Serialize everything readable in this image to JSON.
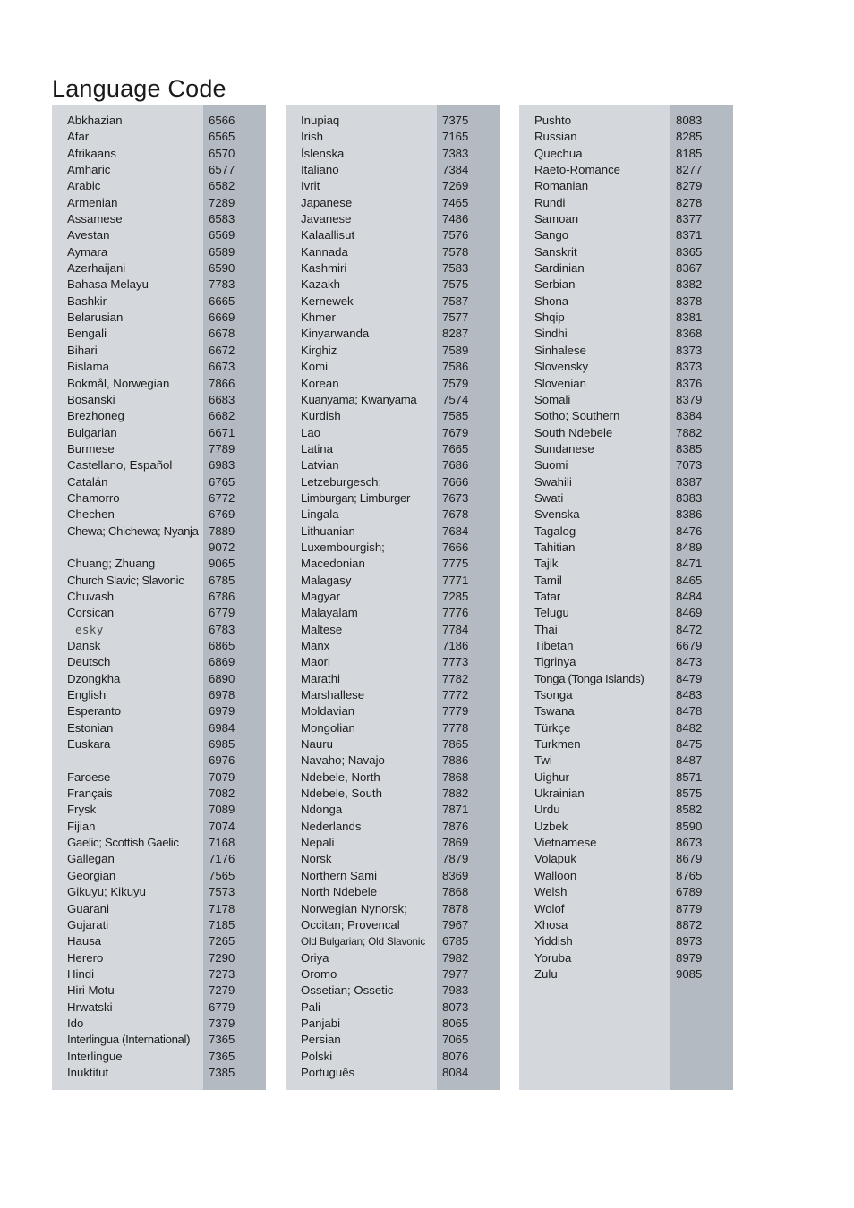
{
  "page": {
    "title": "Language Code"
  },
  "columns": [
    {
      "id": "column-1",
      "rows": [
        {
          "name": "Abkhazian",
          "code": "6566"
        },
        {
          "name": "Afar",
          "code": "6565"
        },
        {
          "name": "Afrikaans",
          "code": "6570"
        },
        {
          "name": "Amharic",
          "code": "6577"
        },
        {
          "name": "Arabic",
          "code": "6582"
        },
        {
          "name": "Armenian",
          "code": "7289"
        },
        {
          "name": "Assamese",
          "code": "6583"
        },
        {
          "name": "Avestan",
          "code": "6569"
        },
        {
          "name": "Aymara",
          "code": "6589"
        },
        {
          "name": "Azerhaijani",
          "code": "6590"
        },
        {
          "name": "Bahasa Melayu",
          "code": "7783"
        },
        {
          "name": "Bashkir",
          "code": "6665"
        },
        {
          "name": "Belarusian",
          "code": "6669"
        },
        {
          "name": "Bengali",
          "code": "6678"
        },
        {
          "name": "Bihari",
          "code": "6672"
        },
        {
          "name": "Bislama",
          "code": "6673"
        },
        {
          "name": "Bokmål, Norwegian",
          "code": "7866"
        },
        {
          "name": "Bosanski",
          "code": "6683"
        },
        {
          "name": "Brezhoneg",
          "code": "6682"
        },
        {
          "name": "Bulgarian",
          "code": "6671"
        },
        {
          "name": "Burmese",
          "code": "7789"
        },
        {
          "name": "Castellano, Español",
          "code": "6983"
        },
        {
          "name": "Catalán",
          "code": "6765"
        },
        {
          "name": "Chamorro",
          "code": "6772"
        },
        {
          "name": "Chechen",
          "code": "6769"
        },
        {
          "name": "Chewa; Chichewa; Nyanja",
          "code": "7889",
          "style": "tight"
        },
        {
          "name": "",
          "code": "9072"
        },
        {
          "name": "Chuang; Zhuang",
          "code": "9065"
        },
        {
          "name": "Church Slavic; Slavonic",
          "code": "6785",
          "style": "tight"
        },
        {
          "name": "Chuvash",
          "code": "6786"
        },
        {
          "name": "Corsican",
          "code": "6779"
        },
        {
          "name": "esky",
          "code": "6783",
          "style": "fallback-glyph"
        },
        {
          "name": "Dansk",
          "code": "6865"
        },
        {
          "name": "Deutsch",
          "code": "6869"
        },
        {
          "name": "Dzongkha",
          "code": "6890"
        },
        {
          "name": "English",
          "code": "6978"
        },
        {
          "name": "Esperanto",
          "code": "6979"
        },
        {
          "name": "Estonian",
          "code": "6984"
        },
        {
          "name": "Euskara",
          "code": "6985"
        },
        {
          "name": "",
          "code": "6976"
        },
        {
          "name": "Faroese",
          "code": "7079"
        },
        {
          "name": "Français",
          "code": "7082"
        },
        {
          "name": "Frysk",
          "code": "7089"
        },
        {
          "name": "Fijian",
          "code": "7074"
        },
        {
          "name": "Gaelic; Scottish Gaelic",
          "code": "7168",
          "style": "tight"
        },
        {
          "name": "Gallegan",
          "code": "7176"
        },
        {
          "name": "Georgian",
          "code": "7565"
        },
        {
          "name": "Gikuyu; Kikuyu",
          "code": "7573"
        },
        {
          "name": "Guarani",
          "code": "7178"
        },
        {
          "name": "Gujarati",
          "code": "7185"
        },
        {
          "name": "Hausa",
          "code": "7265"
        },
        {
          "name": "Herero",
          "code": "7290"
        },
        {
          "name": "Hindi",
          "code": "7273"
        },
        {
          "name": "Hiri Motu",
          "code": "7279"
        },
        {
          "name": "Hrwatski",
          "code": "6779"
        },
        {
          "name": "Ido",
          "code": "7379"
        },
        {
          "name": "Interlingua (International)",
          "code": "7365",
          "style": "tight"
        },
        {
          "name": "Interlingue",
          "code": "7365"
        },
        {
          "name": "Inuktitut",
          "code": "7385"
        }
      ]
    },
    {
      "id": "column-2",
      "rows": [
        {
          "name": "Inupiaq",
          "code": "7375"
        },
        {
          "name": "Irish",
          "code": "7165"
        },
        {
          "name": "Íslenska",
          "code": "7383"
        },
        {
          "name": "Italiano",
          "code": "7384"
        },
        {
          "name": "Ivrit",
          "code": "7269"
        },
        {
          "name": "Japanese",
          "code": "7465"
        },
        {
          "name": "Javanese",
          "code": "7486"
        },
        {
          "name": "Kalaallisut",
          "code": "7576"
        },
        {
          "name": "Kannada",
          "code": "7578"
        },
        {
          "name": "Kashmiri",
          "code": "7583"
        },
        {
          "name": "Kazakh",
          "code": "7575"
        },
        {
          "name": "Kernewek",
          "code": "7587"
        },
        {
          "name": "Khmer",
          "code": "7577"
        },
        {
          "name": "Kinyarwanda",
          "code": "8287"
        },
        {
          "name": "Kirghiz",
          "code": "7589"
        },
        {
          "name": "Komi",
          "code": "7586"
        },
        {
          "name": "Korean",
          "code": "7579"
        },
        {
          "name": "Kuanyama; Kwanyama",
          "code": "7574",
          "style": "tight"
        },
        {
          "name": "Kurdish",
          "code": "7585"
        },
        {
          "name": "Lao",
          "code": "7679"
        },
        {
          "name": "Latina",
          "code": "7665"
        },
        {
          "name": "Latvian",
          "code": "7686"
        },
        {
          "name": "Letzeburgesch;",
          "code": "7666"
        },
        {
          "name": "Limburgan; Limburger",
          "code": "7673",
          "style": "tight"
        },
        {
          "name": "Lingala",
          "code": "7678"
        },
        {
          "name": "Lithuanian",
          "code": "7684"
        },
        {
          "name": "Luxembourgish;",
          "code": "7666"
        },
        {
          "name": "Macedonian",
          "code": "7775"
        },
        {
          "name": "Malagasy",
          "code": "7771"
        },
        {
          "name": "Magyar",
          "code": "7285"
        },
        {
          "name": "Malayalam",
          "code": "7776"
        },
        {
          "name": "Maltese",
          "code": "7784"
        },
        {
          "name": "Manx",
          "code": "7186"
        },
        {
          "name": "Maori",
          "code": "7773"
        },
        {
          "name": "Marathi",
          "code": "7782"
        },
        {
          "name": "Marshallese",
          "code": "7772"
        },
        {
          "name": "Moldavian",
          "code": "7779"
        },
        {
          "name": "Mongolian",
          "code": "7778"
        },
        {
          "name": "Nauru",
          "code": "7865"
        },
        {
          "name": "Navaho; Navajo",
          "code": "7886"
        },
        {
          "name": "Ndebele, North",
          "code": "7868"
        },
        {
          "name": "Ndebele, South",
          "code": "7882"
        },
        {
          "name": "Ndonga",
          "code": "7871"
        },
        {
          "name": "Nederlands",
          "code": "7876"
        },
        {
          "name": "Nepali",
          "code": "7869"
        },
        {
          "name": "Norsk",
          "code": "7879"
        },
        {
          "name": "Northern Sami",
          "code": "8369"
        },
        {
          "name": "North Ndebele",
          "code": "7868"
        },
        {
          "name": "Norwegian Nynorsk;",
          "code": "7878"
        },
        {
          "name": "Occitan; Provencal",
          "code": "7967"
        },
        {
          "name": "Old Bulgarian; Old Slavonic",
          "code": "6785",
          "style": "condensed"
        },
        {
          "name": "Oriya",
          "code": "7982"
        },
        {
          "name": "Oromo",
          "code": "7977"
        },
        {
          "name": "Ossetian; Ossetic",
          "code": "7983"
        },
        {
          "name": "Pali",
          "code": "8073"
        },
        {
          "name": "Panjabi",
          "code": "8065"
        },
        {
          "name": "Persian",
          "code": "7065"
        },
        {
          "name": "Polski",
          "code": "8076"
        },
        {
          "name": "Português",
          "code": "8084"
        }
      ]
    },
    {
      "id": "column-3",
      "rows": [
        {
          "name": "Pushto",
          "code": "8083"
        },
        {
          "name": "Russian",
          "code": "8285"
        },
        {
          "name": "Quechua",
          "code": "8185"
        },
        {
          "name": "Raeto-Romance",
          "code": "8277"
        },
        {
          "name": "Romanian",
          "code": "8279"
        },
        {
          "name": "Rundi",
          "code": "8278"
        },
        {
          "name": "Samoan",
          "code": "8377"
        },
        {
          "name": "Sango",
          "code": "8371"
        },
        {
          "name": "Sanskrit",
          "code": "8365"
        },
        {
          "name": "Sardinian",
          "code": "8367"
        },
        {
          "name": "Serbian",
          "code": "8382"
        },
        {
          "name": "Shona",
          "code": "8378"
        },
        {
          "name": "Shqip",
          "code": "8381"
        },
        {
          "name": "Sindhi",
          "code": "8368"
        },
        {
          "name": "Sinhalese",
          "code": "8373"
        },
        {
          "name": "Slovensky",
          "code": "8373"
        },
        {
          "name": "Slovenian",
          "code": "8376"
        },
        {
          "name": "Somali",
          "code": "8379"
        },
        {
          "name": "Sotho; Southern",
          "code": "8384"
        },
        {
          "name": "South Ndebele",
          "code": "7882"
        },
        {
          "name": "Sundanese",
          "code": "8385"
        },
        {
          "name": "Suomi",
          "code": "7073"
        },
        {
          "name": "Swahili",
          "code": "8387"
        },
        {
          "name": "Swati",
          "code": "8383"
        },
        {
          "name": "Svenska",
          "code": "8386"
        },
        {
          "name": "Tagalog",
          "code": "8476"
        },
        {
          "name": "Tahitian",
          "code": "8489"
        },
        {
          "name": "Tajik",
          "code": "8471"
        },
        {
          "name": "Tamil",
          "code": "8465"
        },
        {
          "name": "Tatar",
          "code": "8484"
        },
        {
          "name": "Telugu",
          "code": "8469"
        },
        {
          "name": "Thai",
          "code": "8472"
        },
        {
          "name": "Tibetan",
          "code": "6679"
        },
        {
          "name": "Tigrinya",
          "code": "8473"
        },
        {
          "name": "Tonga (Tonga Islands)",
          "code": "8479",
          "style": "tight"
        },
        {
          "name": "Tsonga",
          "code": "8483"
        },
        {
          "name": "Tswana",
          "code": "8478"
        },
        {
          "name": "Türkçe",
          "code": "8482"
        },
        {
          "name": "Turkmen",
          "code": "8475"
        },
        {
          "name": "Twi",
          "code": "8487"
        },
        {
          "name": "Uighur",
          "code": "8571"
        },
        {
          "name": "Ukrainian",
          "code": "8575"
        },
        {
          "name": "Urdu",
          "code": "8582"
        },
        {
          "name": "Uzbek",
          "code": "8590"
        },
        {
          "name": "Vietnamese",
          "code": "8673"
        },
        {
          "name": "Volapuk",
          "code": "8679"
        },
        {
          "name": "Walloon",
          "code": "8765"
        },
        {
          "name": "Welsh",
          "code": "6789"
        },
        {
          "name": "Wolof",
          "code": "8779"
        },
        {
          "name": "Xhosa",
          "code": "8872"
        },
        {
          "name": "Yiddish",
          "code": "8973"
        },
        {
          "name": "Yoruba",
          "code": "8979"
        },
        {
          "name": "Zulu",
          "code": "9085"
        }
      ]
    }
  ],
  "colors": {
    "page_background": "#ffffff",
    "panel_background": "#d4d8dc",
    "code_band_background": "#b3bac1",
    "text": "#1c1c1c"
  }
}
